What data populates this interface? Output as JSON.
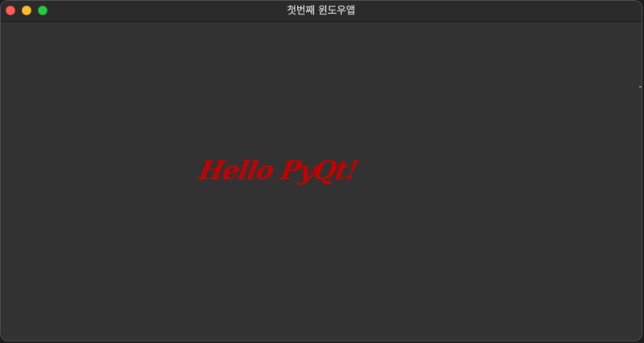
{
  "window": {
    "title": "첫번째 윈도우앱"
  },
  "content": {
    "label_text": "Hello PyQt!",
    "label_color": "#c40000"
  },
  "colors": {
    "window_background": "#323232",
    "titlebar_background": "#2b2b2b",
    "close_button": "#ff5f57",
    "minimize_button": "#febc2e",
    "zoom_button": "#28c840"
  }
}
